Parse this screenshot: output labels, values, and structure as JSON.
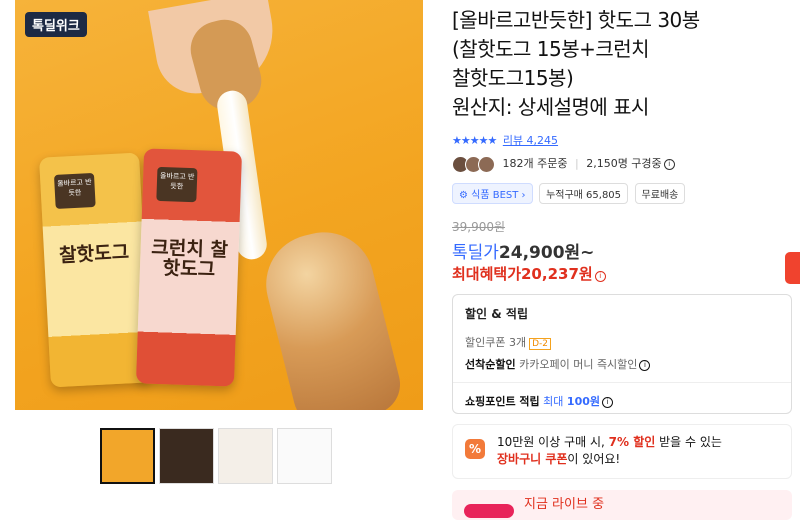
{
  "gallery": {
    "badge": "톡딜위크",
    "pack1_title": "찰핫도그",
    "pack2_title": "크런치 찰핫도그",
    "pack_small": "올바르고 반듯한"
  },
  "product": {
    "title_line1": "[올바르고반듯한] 핫도그 30봉",
    "title_line2": "(찰핫도그 15봉+크런치",
    "title_line3": "찰핫도그15봉)",
    "origin": "원산지: 상세설명에 표시",
    "stars": "★★★★★",
    "review_label": "리뷰 4,245",
    "ordering": "182개 주문중",
    "purchasing": "2,150명 구경중",
    "chip_best": "식품 BEST",
    "chip_cumulative": "누적구매 65,805",
    "chip_shipping": "무료배송",
    "original_price": "39,900원",
    "sale_label": "톡딜가",
    "sale_price": "24,900원~",
    "max_benefit": "최대혜택가20,237원"
  },
  "discount_box": {
    "heading": "할인 & 적립",
    "coupon": "할인쿠폰 3개",
    "coupon_badge": "D-2",
    "first_come_label": "선착순할인",
    "first_come_text": "카카오페이 머니 즉시할인",
    "points_label": "쇼핑포인트 적립",
    "points_max": "최대",
    "points_value": "100원"
  },
  "promo": {
    "icon": "%",
    "line1_a": "10만원 이상 구매 시,",
    "line1_b": "7% 할인",
    "line1_c": "받을 수 있는",
    "line2_a": "장바구니 쿠폰",
    "line2_b": "이 있어요!"
  },
  "live": {
    "text": "지금 라이브 중"
  }
}
